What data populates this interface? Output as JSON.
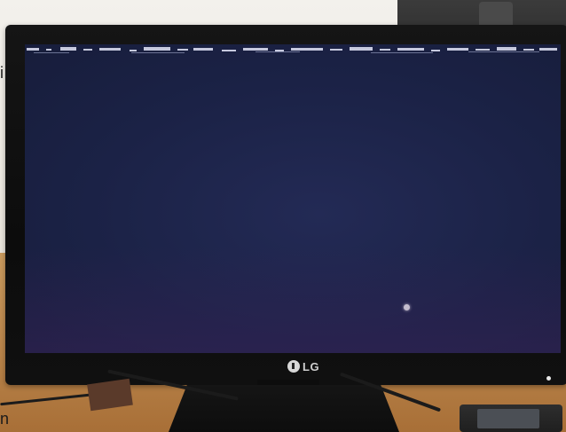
{
  "photo": {
    "description_hidden": "",
    "monitor": {
      "brand_label": "LG",
      "screen": {
        "background_color": "#1b2246",
        "cursor_color": "#f2f2f5"
      }
    },
    "edge_glyphs": {
      "left_top": "i",
      "left_bottom": "n"
    }
  },
  "colors": {
    "screen": "#1b2246",
    "bezel": "#111111",
    "desk": "#b9844a",
    "wall": "#ece8e0"
  }
}
